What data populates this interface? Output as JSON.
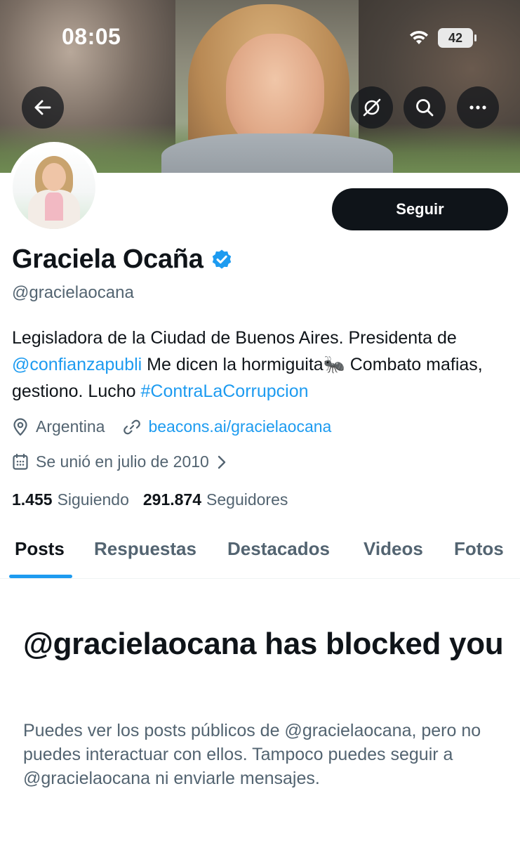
{
  "status_bar": {
    "time": "08:05",
    "battery": "42"
  },
  "header": {
    "back_icon": "arrow-left-icon",
    "actions": [
      "hide-repost-icon",
      "search-icon",
      "more-icon"
    ]
  },
  "profile": {
    "follow_label": "Seguir",
    "display_name": "Graciela Ocaña",
    "verified": true,
    "handle": "@gracielaocana",
    "bio": {
      "text_1": "Legisladora de la Ciudad de Buenos Aires. Presidenta de ",
      "mention": "@confianzapubli",
      "text_2": " Me dicen la hormiguita🐜 Combato mafias, gestiono. Lucho ",
      "hashtag": "#ContraLaCorrupcion"
    },
    "location": "Argentina",
    "website": "beacons.ai/gracielaocana",
    "joined": "Se unió en julio de 2010",
    "following_count": "1.455",
    "following_label": "Siguiendo",
    "followers_count": "291.874",
    "followers_label": "Seguidores"
  },
  "tabs": [
    "Posts",
    "Respuestas",
    "Destacados",
    "Videos",
    "Fotos"
  ],
  "active_tab": "Posts",
  "blocked": {
    "title": "@gracielaocana has blocked you",
    "description": "Puedes ver los posts públicos de @gracielaocana, pero no puedes interactuar con ellos. Tampoco puedes seguir a @gracielaocana ni enviarle mensajes."
  },
  "colors": {
    "accent": "#1d9bf0",
    "text_primary": "#0f1419",
    "text_secondary": "#536471"
  }
}
